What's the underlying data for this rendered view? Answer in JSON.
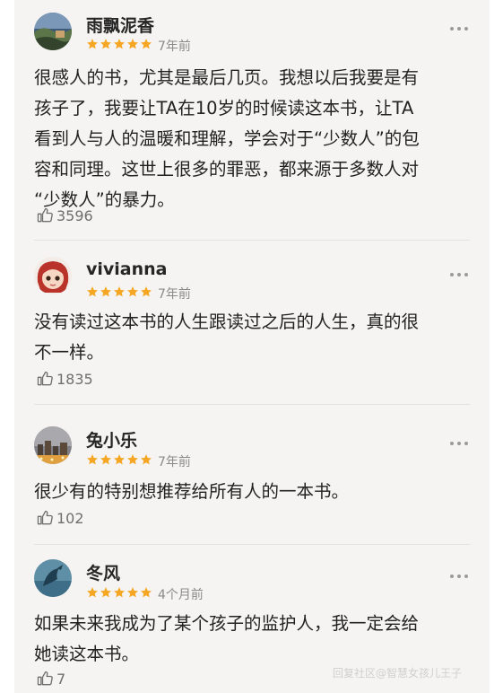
{
  "reviews": [
    {
      "username": "雨飘泥香",
      "rating": 5,
      "time": "7年前",
      "content": "很感人的书，尤其是最后几页。我想以后我要是有\n孩子了，我要让TA在10岁的时候读这本书，让TA\n看到人与人的温暖和理解，学会对于“少数人”的包\n容和同理。这世上很多的罪恶，都来源于多数人对\n“少数人”的暴力。",
      "likes": "3596",
      "avatar_icon": "landscape-avatar"
    },
    {
      "username": "vivianna",
      "rating": 5,
      "time": "7年前",
      "content": "没有读过这本书的人生跟读过之后的人生，真的很\n不一样。",
      "likes": "1835",
      "avatar_icon": "cartoon-girl-avatar"
    },
    {
      "username": "兔小乐",
      "rating": 5,
      "time": "7年前",
      "content": "很少有的特别想推荐给所有人的一本书。",
      "likes": "102",
      "avatar_icon": "night-city-avatar"
    },
    {
      "username": "冬风",
      "rating": 5,
      "time": "4个月前",
      "content": "如果未来我成为了某个孩子的监护人，我一定会给\n她读这本书。",
      "likes": "7",
      "avatar_icon": "dolphin-avatar"
    }
  ],
  "watermark": "回复社区@智慧女孩儿王子",
  "colors": {
    "star": "#f5a623",
    "background": "#f5f4f2",
    "time": "#8a8a8a"
  }
}
